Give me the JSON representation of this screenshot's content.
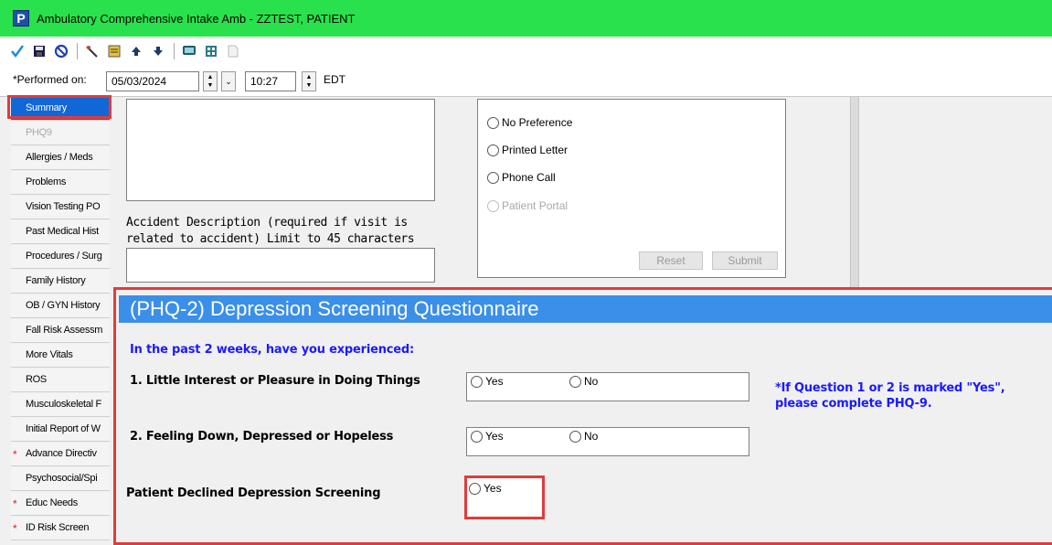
{
  "window": {
    "app_icon": "P",
    "title": "Ambulatory Comprehensive Intake Amb - ZZTEST, PATIENT"
  },
  "toolbar": {
    "icons": [
      "checkmark-icon",
      "save-icon",
      "cancel-icon",
      "edit-icon",
      "notes-icon",
      "up-arrow-icon",
      "down-arrow-icon",
      "monitor-icon",
      "calculator-icon",
      "document-icon"
    ]
  },
  "performed": {
    "label": "*Performed on:",
    "date": "05/03/2024",
    "time": "10:27",
    "timezone": "EDT"
  },
  "sidebar": {
    "items": [
      {
        "label": "Summary",
        "state": "active",
        "required": false
      },
      {
        "label": "PHQ9",
        "state": "disabled",
        "required": false
      },
      {
        "label": "Allergies / Meds",
        "state": "normal",
        "required": false
      },
      {
        "label": "Problems",
        "state": "normal",
        "required": false
      },
      {
        "label": "Vision Testing PO",
        "state": "normal",
        "required": false
      },
      {
        "label": "Past Medical Hist",
        "state": "normal",
        "required": false
      },
      {
        "label": "Procedures / Surg",
        "state": "normal",
        "required": false
      },
      {
        "label": "Family History",
        "state": "normal",
        "required": false
      },
      {
        "label": "OB / GYN History",
        "state": "normal",
        "required": false
      },
      {
        "label": "Fall Risk Assessm",
        "state": "normal",
        "required": false
      },
      {
        "label": "More Vitals",
        "state": "normal",
        "required": false
      },
      {
        "label": "ROS",
        "state": "normal",
        "required": false
      },
      {
        "label": "Musculoskeletal F",
        "state": "normal",
        "required": false
      },
      {
        "label": "Initial Report of W",
        "state": "normal",
        "required": false
      },
      {
        "label": "Advance Directiv",
        "state": "normal",
        "required": true
      },
      {
        "label": "Psychosocial/Spi",
        "state": "normal",
        "required": false
      },
      {
        "label": "Educ Needs",
        "state": "normal",
        "required": true
      },
      {
        "label": "ID Risk Screen",
        "state": "normal",
        "required": true
      }
    ],
    "required_marker": "*"
  },
  "accident": {
    "label": "Accident Description (required if visit is related to accident) Limit to 45 characters",
    "value": ""
  },
  "preference": {
    "options": [
      {
        "label": "No Preference",
        "disabled": false
      },
      {
        "label": "Printed Letter",
        "disabled": false
      },
      {
        "label": "Phone Call",
        "disabled": false
      },
      {
        "label": "Patient Portal",
        "disabled": true
      }
    ],
    "reset_label": "Reset",
    "submit_label": "Submit"
  },
  "phq": {
    "title": "(PHQ-2) Depression Screening Questionnaire",
    "subtitle": "In the past 2 weeks, have you experienced:",
    "q1": {
      "label": "1. Little Interest or Pleasure in Doing Things",
      "yes": "Yes",
      "no": "No"
    },
    "q2": {
      "label": "2. Feeling Down, Depressed or Hopeless",
      "yes": "Yes",
      "no": "No"
    },
    "declined": {
      "label": "Patient Declined Depression Screening",
      "yes": "Yes"
    },
    "note_line1": "*If Question 1 or 2 is marked \"Yes\",",
    "note_line2": "please complete PHQ-9."
  },
  "colors": {
    "title_bar": "#29e14c",
    "active_tab": "#1167d6",
    "section_header": "#3b8fe8",
    "highlight": "#e23b3b",
    "instruction_text": "#1a1aff"
  }
}
